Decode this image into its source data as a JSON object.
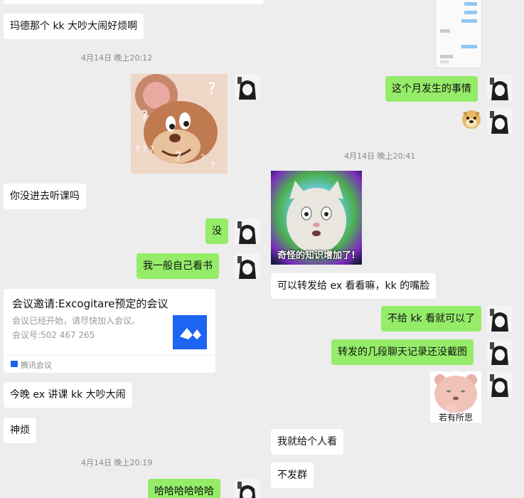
{
  "left_chat": {
    "msg_madeline": "玛德那个 kk 大吵大闹好烦啊",
    "time_1": "4月14日 晚上20:12",
    "msg_not_in_class": "你没进去听课吗",
    "msg_no": "没",
    "msg_read_book": "我一般自己看书",
    "meeting": {
      "title": "会议邀请:Excogitare预定的会议",
      "status": "会议已经开始，请尽快加入会议。",
      "number": "会议号:502 467 265",
      "app": "腾讯会议"
    },
    "msg_tonight": "今晚 ex 讲课 kk 大吵大闹",
    "msg_annoying": "神烦",
    "time_2": "4月14日 晚上20:19",
    "msg_haha": "哈哈哈哈哈哈"
  },
  "right_chat": {
    "msg_this_month": "这个月发生的事情",
    "time_1": "4月14日 晚上20:41",
    "meme_caption": "奇怪的知识增加了!",
    "msg_forward": "可以转发给 ex 看看嘛，kk 的嘴脸",
    "msg_dont_show": "不给 kk 看就可以了",
    "msg_screenshot": "转发的几段聊天记录还没截图",
    "bear_caption": "若有所思",
    "msg_one_person": "我就给个人看",
    "msg_no_group": "不发群"
  },
  "colors": {
    "background": "#ededed",
    "bubble_self": "#95ec69",
    "bubble_other": "#ffffff",
    "meeting_brand": "#1c64f2"
  },
  "icons": [
    "confused-mouse-sticker",
    "avatar-icon",
    "doge-emoji-icon",
    "tencent-meeting-logo-icon"
  ]
}
